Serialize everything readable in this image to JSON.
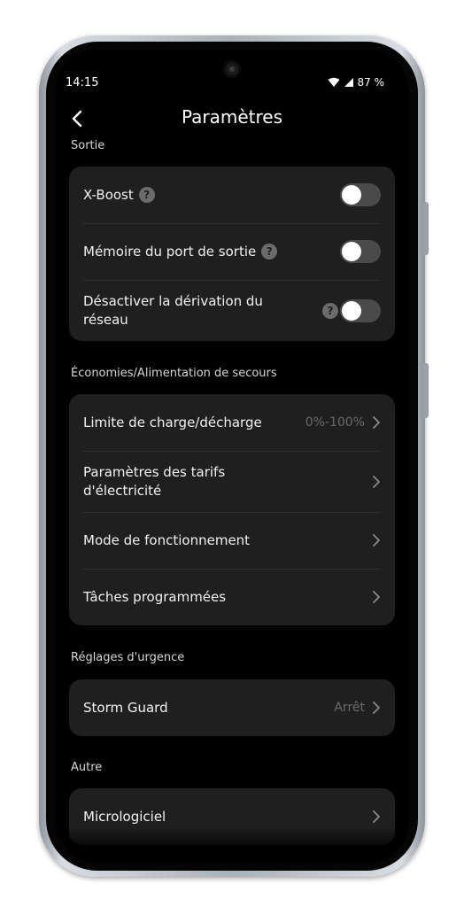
{
  "status_bar": {
    "time": "14:15",
    "battery": "87 %"
  },
  "header": {
    "title": "Paramètres"
  },
  "sections": {
    "output": {
      "label": "Sortie",
      "items": [
        {
          "label": "X-Boost",
          "toggle_on": false
        },
        {
          "label": "Mémoire du port de sortie",
          "toggle_on": false
        },
        {
          "label": "Désactiver la dérivation du réseau",
          "toggle_on": false
        }
      ]
    },
    "savings": {
      "label": "Économies/Alimentation de secours",
      "items": [
        {
          "label": "Limite de charge/décharge",
          "value": "0%-100%"
        },
        {
          "label": "Paramètres des tarifs d'électricité"
        },
        {
          "label": "Mode de fonctionnement"
        },
        {
          "label": "Tâches programmées"
        }
      ]
    },
    "emergency": {
      "label": "Réglages d'urgence",
      "items": [
        {
          "label": "Storm Guard",
          "value": "Arrêt"
        }
      ]
    },
    "other": {
      "label": "Autre",
      "items": [
        {
          "label": "Micrologiciel"
        }
      ]
    }
  },
  "help_glyph": "?",
  "colors": {
    "background": "#000000",
    "card": "#1f1f1f",
    "toggle_off": "#4a4a4a",
    "muted_value": "#6a6a6a"
  }
}
